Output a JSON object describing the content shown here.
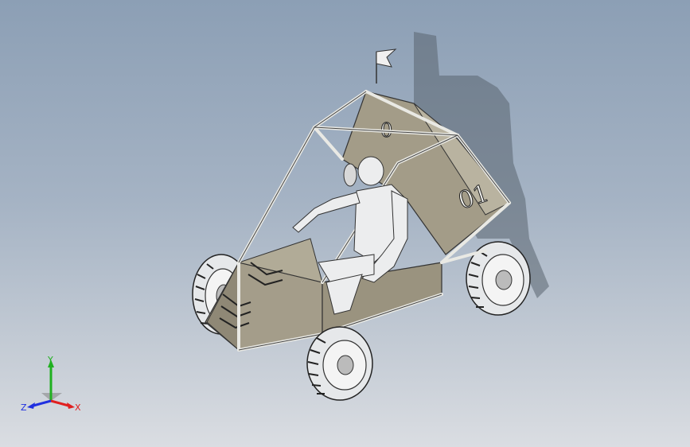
{
  "viewport": {
    "background_top": "#8c9fb5",
    "background_bottom": "#dadde2"
  },
  "model": {
    "car_number_side": "01",
    "car_number_rear": "0"
  },
  "triad": {
    "x_label": "X",
    "y_label": "Y",
    "z_label": "Z",
    "x_color": "#e02020",
    "y_color": "#20b020",
    "z_color": "#2030e0"
  }
}
